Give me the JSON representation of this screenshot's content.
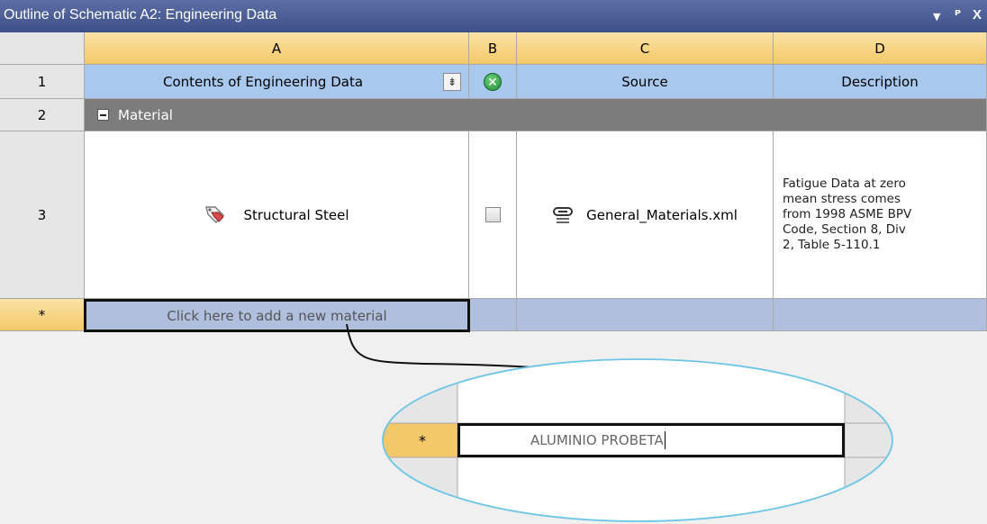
{
  "window": {
    "title": "Outline of Schematic A2: Engineering Data",
    "controls": {
      "dropdown": "▾",
      "pin": "ᵖ",
      "close": "X"
    }
  },
  "grid": {
    "column_letters": [
      "A",
      "B",
      "C",
      "D"
    ],
    "row_numbers": [
      "1",
      "2",
      "3",
      "*"
    ],
    "header_row": {
      "contents": "Contents of Engineering Data",
      "source": "Source",
      "description": "Description"
    },
    "group_row": {
      "label": "Material"
    },
    "material_row": {
      "name": "Structural Steel",
      "source": "General_Materials.xml",
      "description": "Fatigue Data at zero\nmean stress comes\nfrom 1998 ASME BPV\nCode, Section 8, Div\n2, Table 5-110.1"
    },
    "add_row": {
      "placeholder": "Click here to add a new material"
    }
  },
  "zoom_callout": {
    "row_marker": "*",
    "input_value": "ALUMINIO PROBETA"
  },
  "colors": {
    "title_bar": "#3f5089",
    "header_gold": "#f4c869",
    "column_head_blue": "#a9c8ee",
    "group_gray": "#7c7c7c",
    "add_row_blue": "#b1bfde",
    "ellipse_stroke": "#6ec6e6"
  },
  "icons": {
    "sort": "sort-icon",
    "enable": "enable-status-icon",
    "collapse": "collapse-icon",
    "material_tag": "material-tag-icon",
    "link": "link-icon",
    "checkbox": "checkbox-icon"
  }
}
